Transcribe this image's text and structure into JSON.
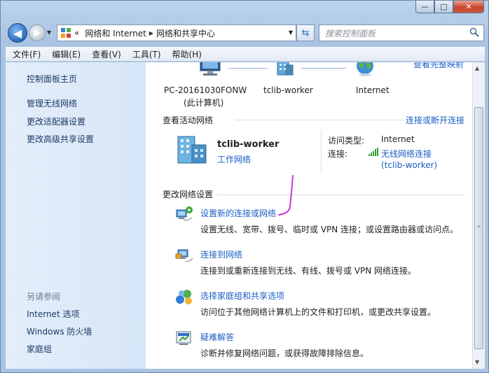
{
  "window": {
    "minimize": "—",
    "maximize": "□",
    "close": "✕"
  },
  "nav": {
    "back_icon": "◀",
    "forward_icon": "▶",
    "address_prefix": "«",
    "breadcrumb": [
      "网络和 Internet",
      "网络和共享中心"
    ],
    "search_placeholder": "搜索控制面板"
  },
  "menu": [
    "文件(F)",
    "编辑(E)",
    "查看(V)",
    "工具(T)",
    "帮助(H)"
  ],
  "sidebar": {
    "items": [
      "控制面板主页",
      "管理无线网络",
      "更改适配器设置",
      "更改高级共享设置"
    ],
    "see_also_heading": "另请参阅",
    "see_also": [
      "Internet 选项",
      "Windows 防火墙",
      "家庭组"
    ]
  },
  "map": {
    "full_map_link": "查看完整映射",
    "nodes": [
      {
        "label": "PC-20161030FONW",
        "sub": "(此计算机)"
      },
      {
        "label": "tclib-worker",
        "sub": ""
      },
      {
        "label": "Internet",
        "sub": ""
      }
    ]
  },
  "active": {
    "heading": "查看活动网络",
    "connect_link": "连接或断开连接",
    "network_name": "tclib-worker",
    "network_type": "工作网络",
    "access_type_label": "访问类型:",
    "access_type_value": "Internet",
    "connection_label": "连接:",
    "connection_value": "无线网络连接",
    "connection_ssid": "(tclib-worker)"
  },
  "change": {
    "heading": "更改网络设置",
    "items": [
      {
        "link": "设置新的连接或网络",
        "desc": "设置无线、宽带、拨号、临时或 VPN 连接；或设置路由器或访问点。"
      },
      {
        "link": "连接到网络",
        "desc": "连接到或重新连接到无线、有线、拨号或 VPN 网络连接。"
      },
      {
        "link": "选择家庭组和共享选项",
        "desc": "访问位于其他网络计算机上的文件和打印机，或更改共享设置。"
      },
      {
        "link": "疑难解答",
        "desc": "诊断并修复网络问题，或获得故障排除信息。"
      }
    ]
  },
  "colors": {
    "link": "#1a5ec4",
    "annotation_mark": "#c535d6"
  }
}
